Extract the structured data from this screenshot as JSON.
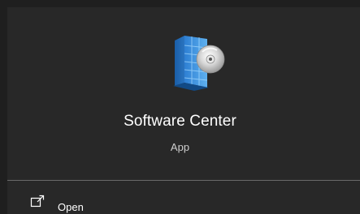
{
  "app": {
    "name": "Software Center",
    "type": "App",
    "icon": "software-center-icon"
  },
  "actions": [
    {
      "label": "Open",
      "icon": "open-external-icon"
    }
  ],
  "colors": {
    "background": "#282828",
    "text": "#ffffff",
    "subtext": "#cfcfcf",
    "divider": "#6a6a6a"
  }
}
